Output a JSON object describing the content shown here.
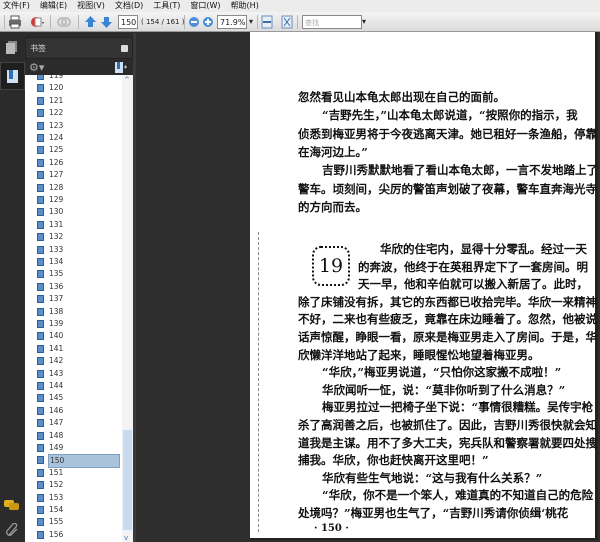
{
  "menu": [
    "文件(F)",
    "编辑(E)",
    "视图(V)",
    "文档(D)",
    "工具(T)",
    "窗口(W)",
    "帮助(H)"
  ],
  "toolbar": {
    "page_input": "150",
    "page_count": "( 154 / 161 )",
    "zoom_value": "71.9%",
    "search_placeholder": "查找"
  },
  "sidebar": {
    "title": "书签",
    "bookmarks": [
      "119",
      "120",
      "121",
      "122",
      "123",
      "124",
      "125",
      "126",
      "127",
      "128",
      "129",
      "130",
      "131",
      "132",
      "133",
      "134",
      "135",
      "136",
      "137",
      "138",
      "139",
      "140",
      "141",
      "142",
      "143",
      "144",
      "145",
      "146",
      "147",
      "148",
      "149",
      "150",
      "151",
      "152",
      "153",
      "154",
      "155",
      "156"
    ],
    "selected": "150"
  },
  "document": {
    "block1": [
      "忽然看见山本龟太郎出现在自己的面前。",
      "“吉野先生，”山本龟太郎说道，“按照你的指示，我",
      "侦悉到梅亚男将于今夜逃离天津。她已租好一条渔船，停靠",
      "在海河边上。”",
      "吉野川秀默默地看了看山本龟太郎，一言不发地踏上了",
      "警车。顷刻间，尖厉的警笛声划破了夜幕，警车直奔海光寺",
      "的方向而去。"
    ],
    "chapter_number": "19",
    "block2": [
      "华欣的住宅内，显得十分零乱。经过一天",
      "的奔波，他终于在英租界定下了一套房间。明",
      "天一早，他和辛伯就可以搬入新居了。此时，",
      "除了床铺没有拆，其它的东西都已收拾完毕。华欣一来精神",
      "不好，二来也有些疲乏，竟靠在床边睡着了。忽然，他被说",
      "话声惊醒，睁眼一看，原来是梅亚男走入了房间。于是，华",
      "欣懒洋洋地站了起来，睡眼惺忪地望着梅亚男。",
      "“华欣，”梅亚男说道，“只怕你这家搬不成啦！”",
      "华欣闻听一怔，说：“莫非你听到了什么消息？”",
      "梅亚男拉过一把椅子坐下说：“事情很糟糕。吴传宇枪",
      "杀了高润善之后，也被抓住了。因此，吉野川秀很快就会知",
      "道我是主谋。用不了多大工夫，宪兵队和警察署就要四处搜",
      "捕我。华欣，你也赶快离开这里吧！”",
      "华欣有些生气地说：“这与我有什么关系？”",
      "“华欣，你不是一个笨人，难道真的不知道自己的危险",
      "处境吗？”梅亚男也生气了，“吉野川秀请你侦缉‘桃花"
    ],
    "page_number": "· 150 ·"
  },
  "colors": {
    "background": "#2e2e2e",
    "selection": "#a9c3dc",
    "scroll_thumb": "#c8daf0"
  }
}
